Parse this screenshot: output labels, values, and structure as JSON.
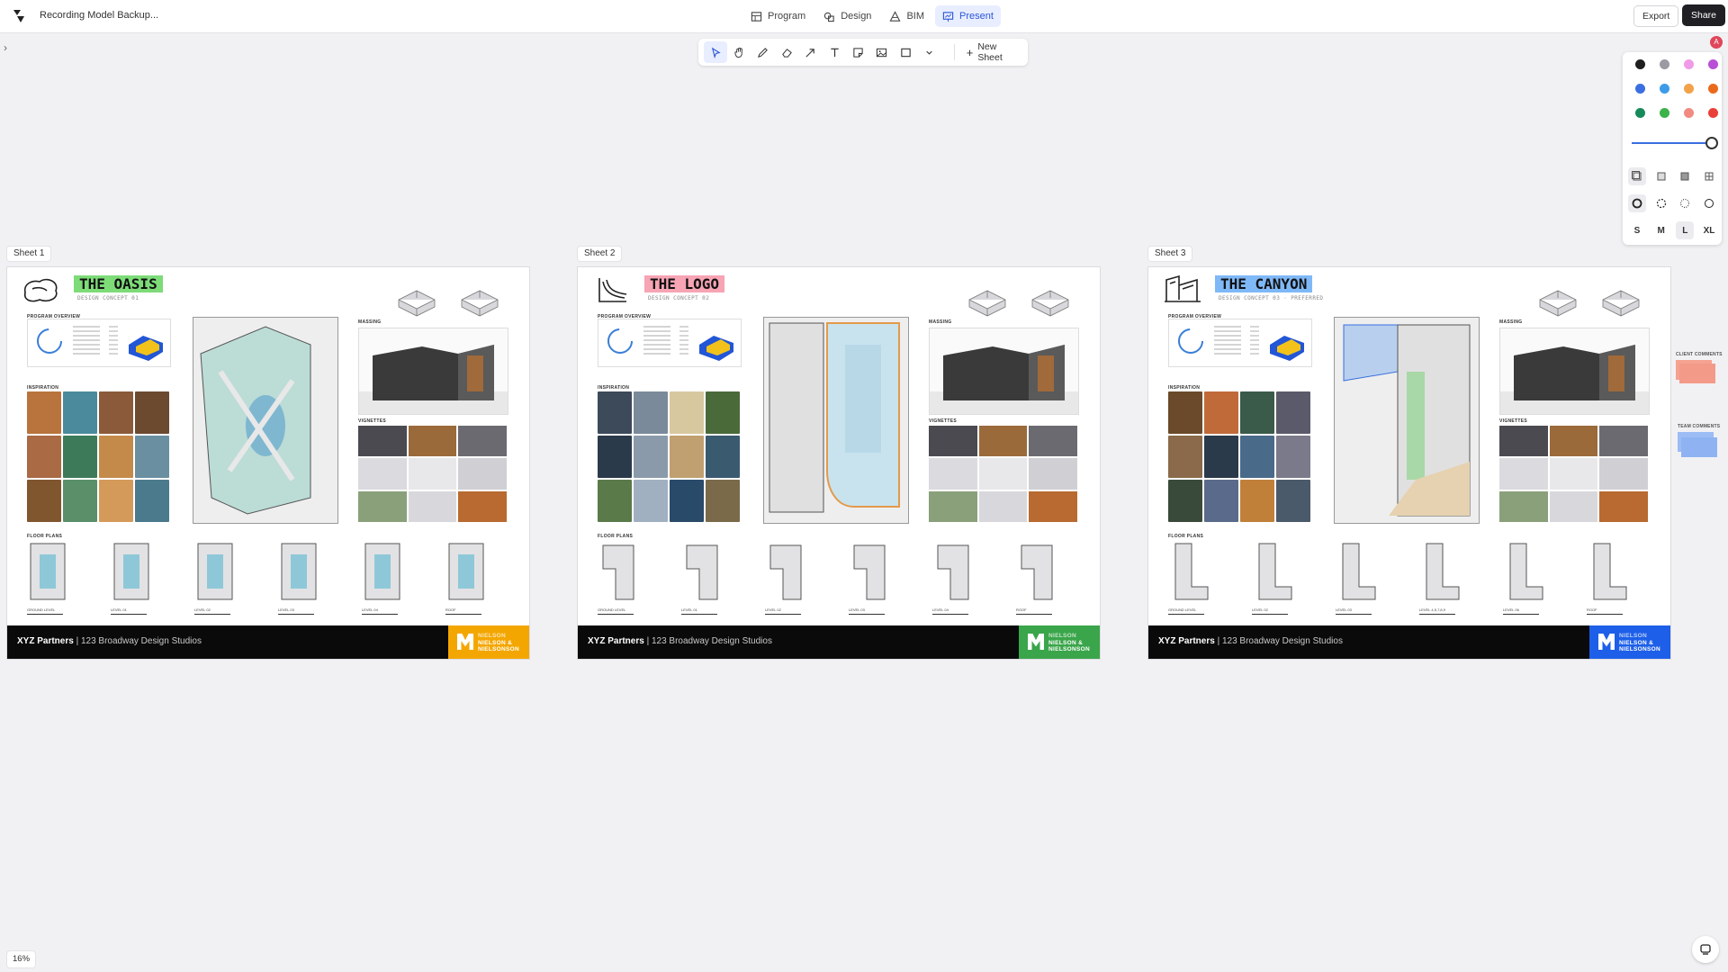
{
  "app": {
    "document_title": "Recording Model Backup...",
    "nav": [
      {
        "label": "Program",
        "icon": "table-icon"
      },
      {
        "label": "Design",
        "icon": "shapes-icon"
      },
      {
        "label": "BIM",
        "icon": "cone-icon"
      },
      {
        "label": "Present",
        "icon": "presentation-icon",
        "active": true
      }
    ],
    "export_label": "Export",
    "share_label": "Share",
    "avatar_initial": "A"
  },
  "toolbar": {
    "tools": [
      "select-icon",
      "hand-icon",
      "pencil-icon",
      "eraser-icon",
      "arrow-icon",
      "text-icon",
      "sticky-note-icon",
      "image-icon",
      "rectangle-icon",
      "chevron-down-icon"
    ],
    "new_sheet_label": "New Sheet"
  },
  "palette": {
    "colors": [
      "#1f1f1f",
      "#9a9aa2",
      "#f09ae8",
      "#b84fd6",
      "#3b6ee0",
      "#3d9be9",
      "#f2a24a",
      "#ea6a1c",
      "#178a5c",
      "#3bb24a",
      "#f18a80",
      "#e8403a"
    ],
    "sizes": [
      "S",
      "M",
      "L",
      "XL"
    ],
    "selected_size": "L"
  },
  "sheets": [
    {
      "label": "Sheet 1",
      "title": "THE OASIS",
      "subtitle": "DESIGN CONCEPT 01",
      "highlight": "#7ddb78",
      "brand_color": "#f4a600",
      "footer_company": "XYZ Partners",
      "footer_project": "123 Broadway Design Studios",
      "brand_lines": [
        "NIELSON",
        "NIELSON &",
        "NIELSONSON"
      ],
      "sections": {
        "program": "PROGRAM OVERVIEW",
        "inspiration": "INSPIRATION",
        "massing": "MASSING",
        "vignettes": "VIGNETTES",
        "floorplans": "FLOOR PLANS"
      },
      "levels": [
        "GROUND LEVEL",
        "LEVEL 01",
        "LEVEL 02",
        "LEVEL 03",
        "LEVEL 04",
        "ROOF"
      ]
    },
    {
      "label": "Sheet 2",
      "title": "THE LOGO",
      "subtitle": "DESIGN CONCEPT 02",
      "highlight": "#f7a4b4",
      "brand_color": "#3aa54a",
      "footer_company": "XYZ Partners",
      "footer_project": "123 Broadway Design Studios",
      "brand_lines": [
        "NIELSON",
        "NIELSON &",
        "NIELSONSON"
      ],
      "sections": {
        "program": "PROGRAM OVERVIEW",
        "inspiration": "INSPIRATION",
        "massing": "MASSING",
        "vignettes": "VIGNETTES",
        "floorplans": "FLOOR PLANS"
      },
      "levels": [
        "GROUND LEVEL",
        "LEVEL 01",
        "LEVEL 02",
        "LEVEL 03",
        "LEVEL 04",
        "ROOF"
      ]
    },
    {
      "label": "Sheet 3",
      "title": "THE CANYON",
      "subtitle": "DESIGN CONCEPT 03 · PREFERRED",
      "highlight": "#7fb8f7",
      "brand_color": "#1d5fe8",
      "footer_company": "XYZ Partners",
      "footer_project": "123 Broadway Design Studios",
      "brand_lines": [
        "NIELSON",
        "NIELSON &",
        "NIELSONSON"
      ],
      "sections": {
        "program": "PROGRAM OVERVIEW",
        "inspiration": "INSPIRATION",
        "massing": "MASSING",
        "vignettes": "VIGNETTES",
        "floorplans": "FLOOR PLANS"
      },
      "levels": [
        "GROUND LEVEL",
        "LEVEL 02",
        "LEVEL 03",
        "LEVEL 4,5,7,8,9",
        "LEVEL 06",
        "ROOF"
      ]
    }
  ],
  "side_notes": {
    "client": "CLIENT COMMENTS",
    "team": "TEAM COMMENTS"
  },
  "zoom_level": "16%"
}
